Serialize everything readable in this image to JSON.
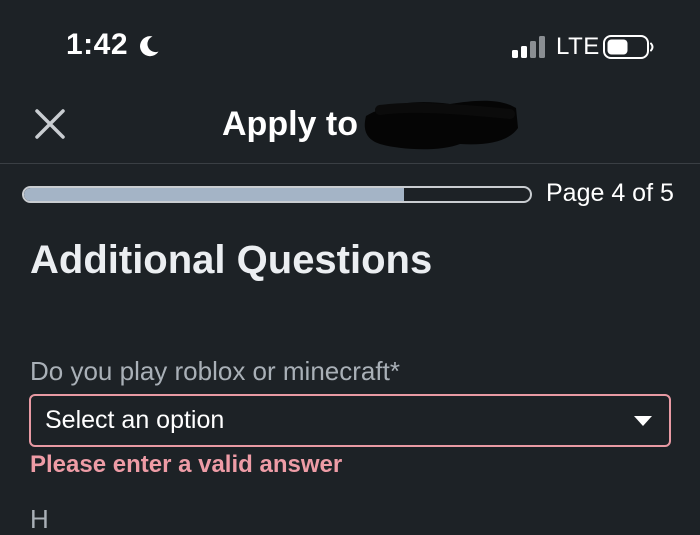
{
  "status_bar": {
    "time": "1:42",
    "network": "LTE",
    "icons": [
      "moon-icon",
      "signal-icon",
      "battery-icon"
    ]
  },
  "header": {
    "title": "Apply to Ja",
    "close_icon": "close-icon"
  },
  "progress": {
    "fraction": 0.75,
    "page_label": "Page 4 of 5"
  },
  "form": {
    "section_title": "Additional Questions",
    "question_label": "Do you play roblox or minecraft*",
    "select_value": "Select an option",
    "error_text": "Please enter a valid answer",
    "next_question_partial": "H"
  },
  "colors": {
    "background": "#1d2226",
    "progress_fill": "#a4b4c6",
    "error": "#ee9ca6",
    "muted_text": "#a9b0b7"
  }
}
